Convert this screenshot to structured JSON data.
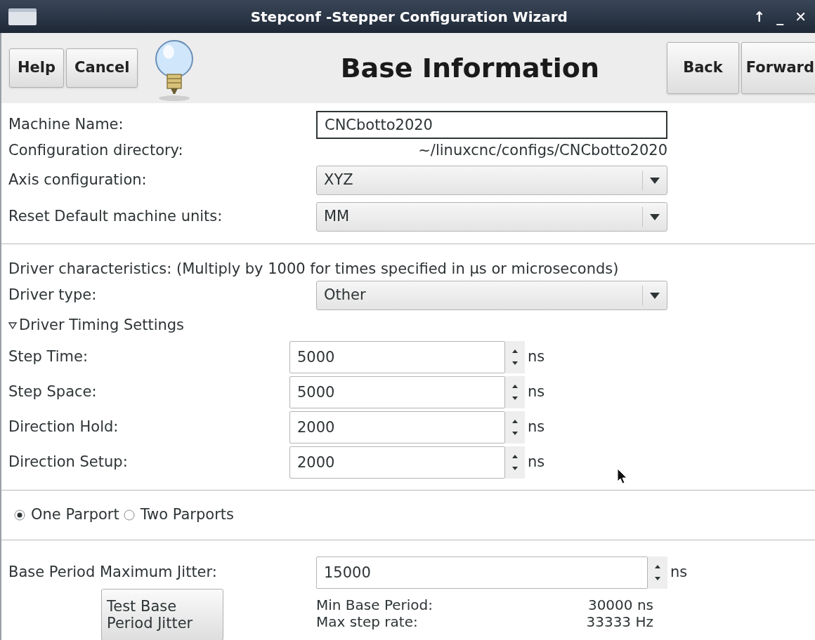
{
  "window": {
    "title": "Stepconf -Stepper Configuration Wizard",
    "controls": [
      "↑",
      "_",
      "✕"
    ]
  },
  "toolbar": {
    "left_buttons": [
      "Help",
      "Cancel"
    ],
    "heading": "Base Information",
    "right_buttons": [
      "Back",
      "Forward"
    ]
  },
  "basic_fields": [
    {
      "kind": "entry",
      "label": "Machine Name:",
      "value": "CNCbotto2020"
    },
    {
      "kind": "info",
      "label": "Configuration directory:",
      "value": "~/linuxcnc/configs/CNCbotto2020"
    },
    {
      "kind": "dropdown",
      "label": "Axis configuration:",
      "value": "XYZ"
    },
    {
      "kind": "dropdown",
      "label": "Reset Default machine units:",
      "value": "MM"
    }
  ],
  "driver": {
    "note": "Driver characteristics: (Multiply by 1000 for times specified in µs or microseconds)",
    "type": {
      "label": "Driver type:",
      "value": "Other"
    },
    "timing": {
      "label": "Driver Timing Settings",
      "expanded": true,
      "fields": [
        {
          "label": "Step Time:",
          "value": "5000",
          "unit": "ns"
        },
        {
          "label": "Step Space:",
          "value": "5000",
          "unit": "ns"
        },
        {
          "label": "Direction Hold:",
          "value": "2000",
          "unit": "ns"
        },
        {
          "label": "Direction Setup:",
          "value": "2000",
          "unit": "ns"
        }
      ]
    }
  },
  "parport": [
    {
      "label": "One Parport",
      "selected": true
    },
    {
      "label": "Two Parports",
      "selected": false
    }
  ],
  "jitter": {
    "label": "Base Period Maximum Jitter:",
    "value": "15000",
    "unit": "ns",
    "test_button": "Test Base\nPeriod Jitter",
    "stats": [
      {
        "label": "Min Base Period:",
        "value": "30000 ns"
      },
      {
        "label": "Max step rate:",
        "value": "33333 Hz"
      }
    ]
  }
}
